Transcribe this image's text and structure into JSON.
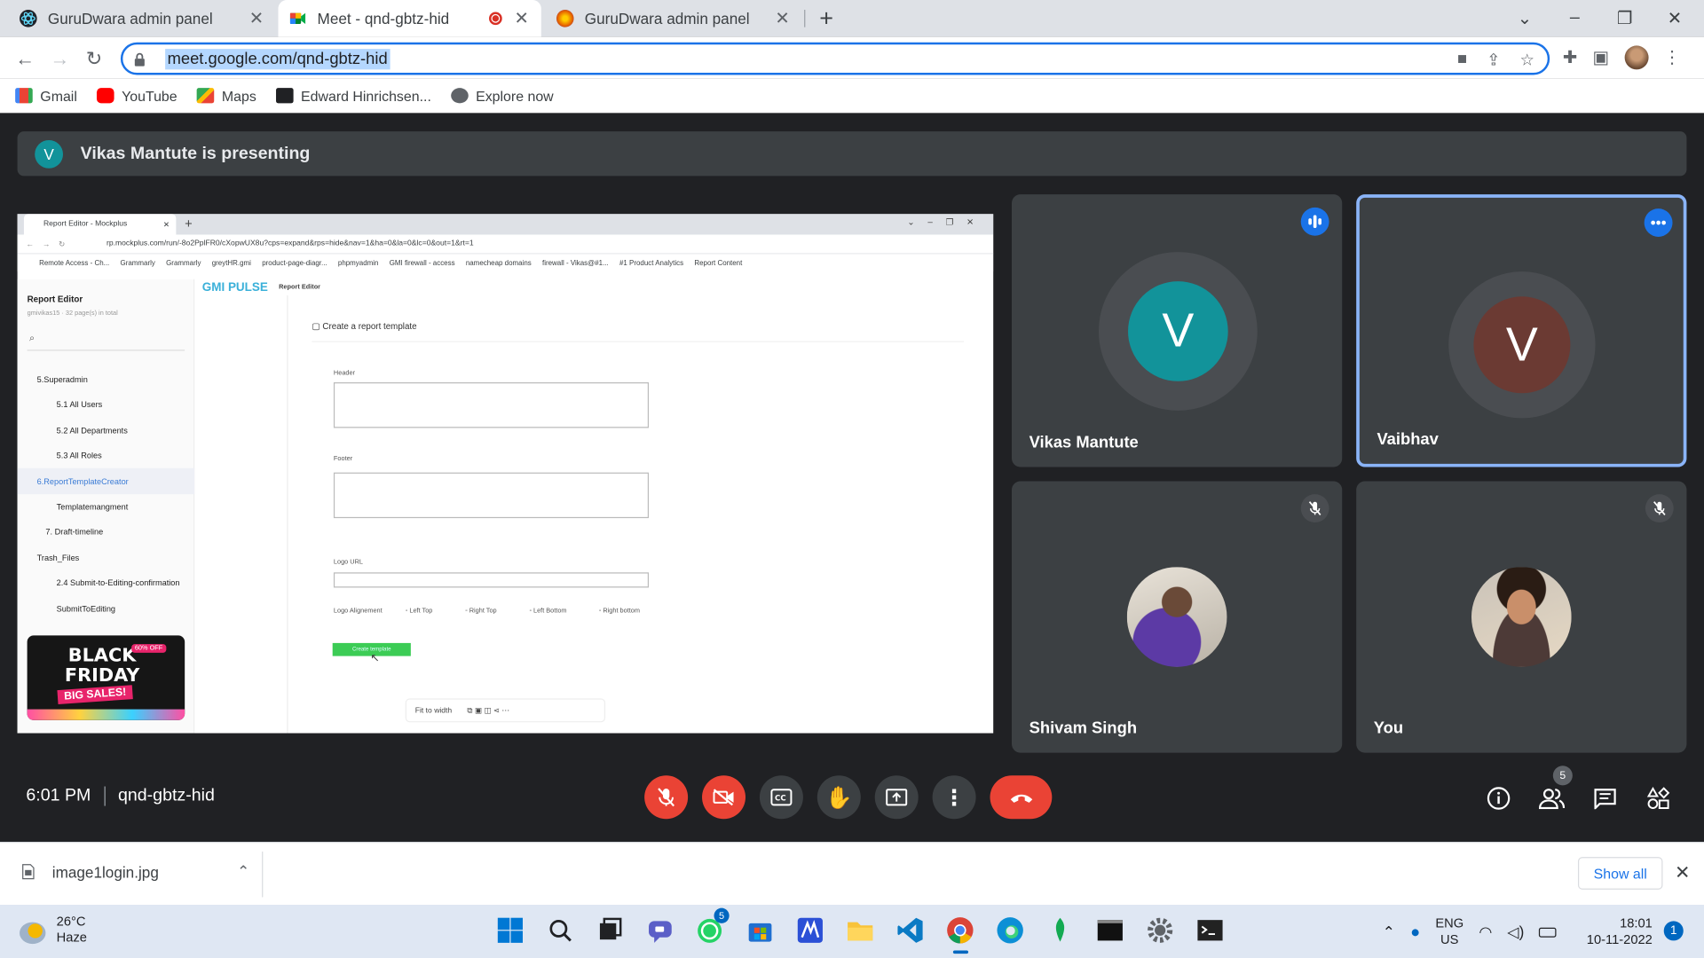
{
  "browser": {
    "tabs": [
      {
        "title": "GuruDwara admin panel",
        "active": false,
        "icon": "react-icon"
      },
      {
        "title": "Meet - qnd-gbtz-hid",
        "active": true,
        "icon": "meet-icon",
        "recording": true
      },
      {
        "title": "GuruDwara admin panel",
        "active": false,
        "icon": "firefox-icon"
      }
    ],
    "url": "meet.google.com/qnd-gbtz-hid",
    "bookmarks": [
      "Gmail",
      "YouTube",
      "Maps",
      "Edward Hinrichsen...",
      "Explore now"
    ]
  },
  "meet": {
    "presenting_banner": "Vikas Mantute is presenting",
    "presenter_initial": "V",
    "participants": [
      {
        "name": "Vikas Mantute",
        "initial": "V",
        "color": "#12939a",
        "speaking": true
      },
      {
        "name": "Vaibhav",
        "initial": "V",
        "color": "#6b3a33",
        "pinned": true
      },
      {
        "name": "Shivam Singh",
        "muted": true,
        "photo": true
      },
      {
        "name": "You",
        "muted": true,
        "photo": true
      }
    ],
    "time": "6:01 PM",
    "meeting_code": "qnd-gbtz-hid",
    "participant_count": "5"
  },
  "shared_screen": {
    "tab_title": "Report Editor - Mockplus",
    "url": "rp.mockplus.com/run/-8o2PplFR0/cXopwUX8u?cps=expand&rps=hide&nav=1&ha=0&la=0&lc=0&out=1&rt=1",
    "bookmarks": [
      "Remote Access - Ch...",
      "Grammarly",
      "Grammarly",
      "greytHR.gmi",
      "product-page-diagr...",
      "phpmyadmin",
      "GMI firewall - access",
      "namecheap domains",
      "firewall - Vikas@#1...",
      "#1 Product Analytics",
      "Report Content"
    ],
    "sidebar_title": "Report Editor",
    "sidebar_subtitle": "gmivikas15 · 32 page(s) in total",
    "tree": [
      "5.Superadmin",
      "5.1 All Users",
      "5.2 All Departments",
      "5.3 All Roles",
      "6.ReportTemplateCreator",
      "Templatemangment",
      "7. Draft-timeline",
      "Trash_Files",
      "2.4 Submit-to-Editing-confirmation",
      "SubmitToEditing"
    ],
    "promo": {
      "line1": "BLACK",
      "line2": "FRIDAY",
      "line3": "BIG SALES!",
      "badge": "60% OFF"
    },
    "logo": "GMI PULSE",
    "logo_sub": "Report Editor",
    "page_heading": "Create a report template",
    "fields": [
      "Header",
      "Footer",
      "Logo URL",
      "Logo Alignement"
    ],
    "alignment_options": [
      "Left Top",
      "Right Top",
      "Left Bottom",
      "Right bottom"
    ],
    "button": "Create template",
    "zoom": "Fit to width"
  },
  "downloads": {
    "file": "image1login.jpg",
    "show_all": "Show all"
  },
  "taskbar": {
    "temp": "26°C",
    "weather": "Haze",
    "lang1": "ENG",
    "lang2": "US",
    "time": "18:01",
    "date": "10-11-2022",
    "notifications": "1",
    "whatsapp_badge": "5"
  }
}
